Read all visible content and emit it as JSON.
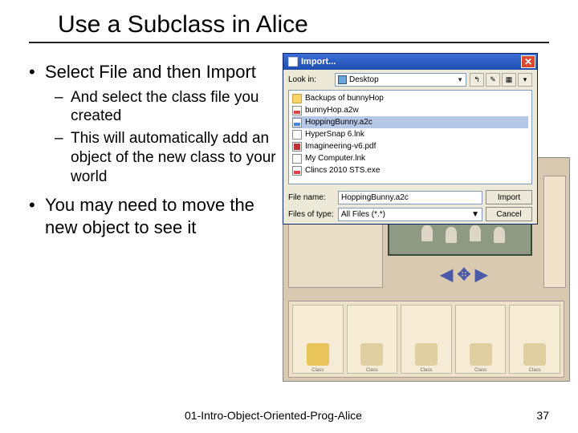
{
  "title": "Use a Subclass in Alice",
  "bullets": {
    "b1": "Select File and then Import",
    "b1a": "And select the class file you created",
    "b1b": "This will automatically add an object of the new class to your world",
    "b2": "You may need to move the new object to see it"
  },
  "dialog": {
    "title": "Import...",
    "lookin_label": "Look in:",
    "lookin_value": "Desktop",
    "files": [
      {
        "icon": "folder",
        "name": "Backups of bunnyHop"
      },
      {
        "icon": "a2w",
        "name": "bunnyHop.a2w"
      },
      {
        "icon": "a2c",
        "name": "HoppingBunny.a2c",
        "selected": true
      },
      {
        "icon": "lnk",
        "name": "HyperSnap 6.lnk"
      },
      {
        "icon": "pdf",
        "name": "Imagineering-v6.pdf"
      },
      {
        "icon": "lnk",
        "name": "My Computer.lnk"
      },
      {
        "icon": "a2w",
        "name": "Clincs 2010 STS.exe"
      }
    ],
    "filename_label": "File name:",
    "filename_value": "HoppingBunny.a2c",
    "filetype_label": "Files of type:",
    "filetype_value": "All Files (*.*)",
    "import_btn": "Import",
    "cancel_btn": "Cancel"
  },
  "gallery": [
    "Class",
    "Class",
    "Class",
    "Class",
    "Class"
  ],
  "footer": {
    "name": "01-Intro-Object-Oriented-Prog-Alice",
    "page": "37"
  }
}
